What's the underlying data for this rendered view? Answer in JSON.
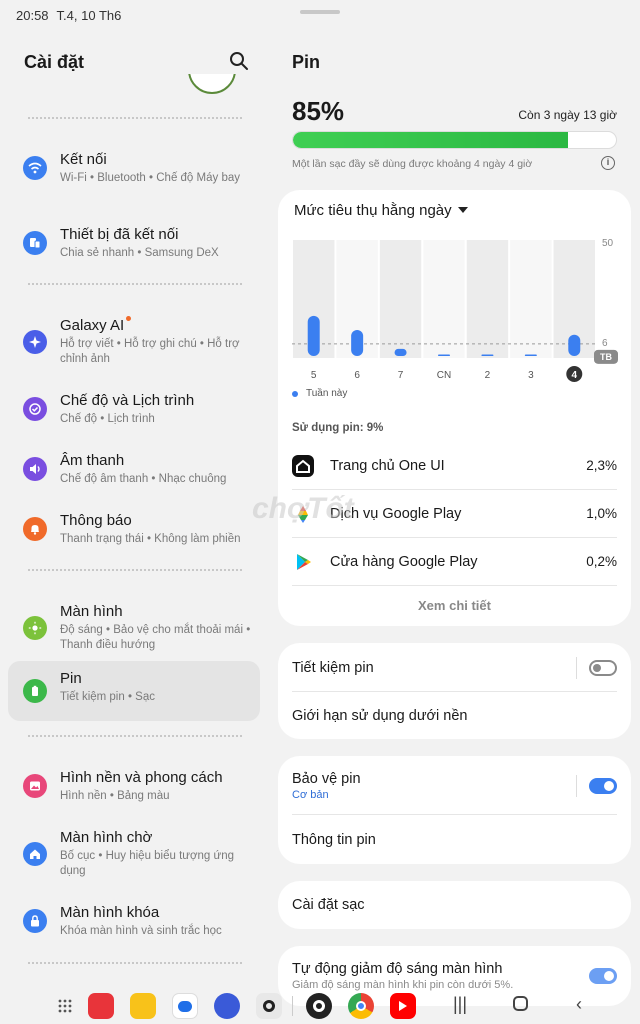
{
  "status": {
    "time": "20:58",
    "date": "T.4, 10 Th6",
    "battery": "85"
  },
  "left": {
    "title": "Cài đặt",
    "items": [
      {
        "title": "Kết nối",
        "sub": "Wi-Fi • Bluetooth • Chế độ Máy bay",
        "icon": "wifi-icon",
        "color": "#3b7ff0"
      },
      {
        "title": "Thiết bị đã kết nối",
        "sub": "Chia sẻ nhanh • Samsung DeX",
        "icon": "devices-icon",
        "color": "#3b7ff0"
      },
      {
        "title": "Galaxy AI",
        "sub": "Hỗ trợ viết • Hỗ trợ ghi chú • Hỗ trợ chỉnh ảnh",
        "icon": "sparkle-icon",
        "color": "#4a5ee8"
      },
      {
        "title": "Chế độ và Lịch trình",
        "sub": "Chế độ • Lịch trình",
        "icon": "check-circle-icon",
        "color": "#7a4ee0"
      },
      {
        "title": "Âm thanh",
        "sub": "Chế độ âm thanh • Nhạc chuông",
        "icon": "volume-icon",
        "color": "#7a4ee0"
      },
      {
        "title": "Thông báo",
        "sub": "Thanh trạng thái • Không làm phiền",
        "icon": "bell-icon",
        "color": "#f06a2a"
      },
      {
        "title": "Màn hình",
        "sub": "Độ sáng • Bảo vệ cho mắt thoải mái • Thanh điều hướng",
        "icon": "sun-icon",
        "color": "#7cc23b"
      },
      {
        "title": "Pin",
        "sub": "Tiết kiệm pin • Sạc",
        "icon": "battery-icon",
        "color": "#3cb84a"
      },
      {
        "title": "Hình nền và phong cách",
        "sub": "Hình nền • Bảng màu",
        "icon": "image-icon",
        "color": "#e8477a"
      },
      {
        "title": "Màn hình chờ",
        "sub": "Bố cục • Huy hiệu biểu tượng ứng dụng",
        "icon": "home-icon",
        "color": "#3b7ff0"
      },
      {
        "title": "Màn hình khóa",
        "sub": "Khóa màn hình và sinh trắc học",
        "icon": "lock-icon",
        "color": "#3b7ff0"
      }
    ]
  },
  "right": {
    "title": "Pin",
    "percent": "85%",
    "level": 0.85,
    "remaining": "Còn 3 ngày 13 giờ",
    "note": "Một lần sạc đầy sẽ dùng được khoảng 4 ngày 4 giờ",
    "dropdown": "Mức tiêu thụ hằng ngày",
    "legend": "Tuần này",
    "usage_header": "Sử dụng pin: 9%",
    "apps": [
      {
        "name": "Trang chủ One UI",
        "pct": "2,3%"
      },
      {
        "name": "Dịch vụ Google Play",
        "pct": "1,0%"
      },
      {
        "name": "Cửa hàng Google Play",
        "pct": "0,2%"
      }
    ],
    "see_more": "Xem chi tiết",
    "power_saving": "Tiết kiệm pin",
    "bg_limit": "Giới hạn sử dụng dưới nền",
    "protect": "Bảo vệ pin",
    "protect_sub": "Cơ bản",
    "info": "Thông tin pin",
    "charging": "Cài đặt sạc",
    "auto_dim": "Tự động giảm độ sáng màn hình",
    "auto_dim_sub": "Giảm độ sáng màn hình khi pin còn dưới 5%."
  },
  "chart_data": {
    "type": "bar",
    "categories": [
      "5",
      "6",
      "7",
      "CN",
      "2",
      "3",
      "4"
    ],
    "values": [
      17,
      11,
      3,
      0,
      0,
      0.5,
      9
    ],
    "average": 6,
    "ylim": [
      0,
      50
    ],
    "yticks": [
      "50",
      "6"
    ],
    "avg_label": "TB",
    "selected": "4"
  },
  "watermark": "chợTốt"
}
